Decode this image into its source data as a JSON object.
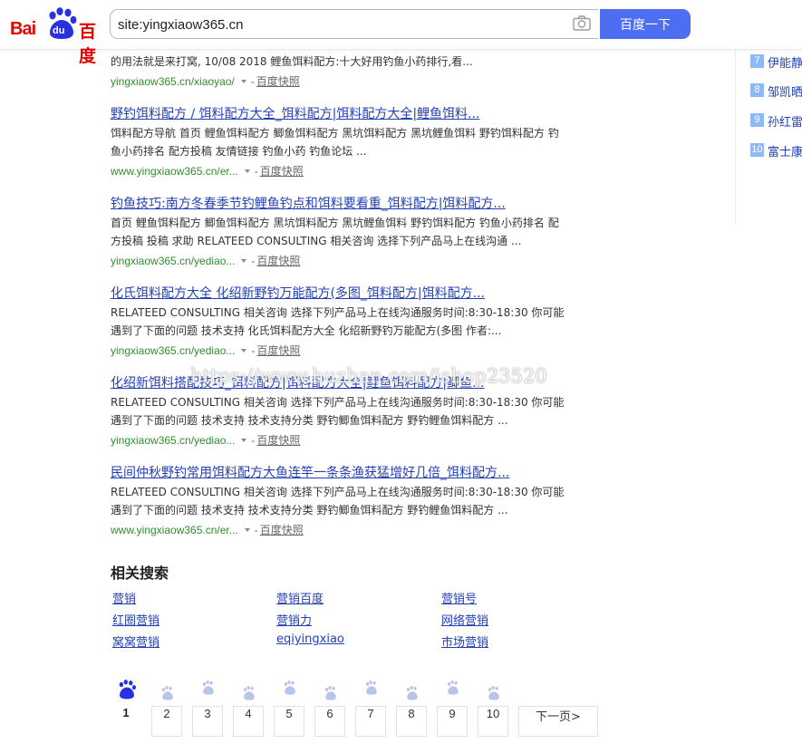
{
  "header": {
    "logo_text_left": "Bai",
    "logo_text_paw": "du",
    "logo_text_right": "百度",
    "search_value": "site:yingxiaow365.cn",
    "search_button": "百度一下",
    "camera_icon": "camera-icon"
  },
  "hot_list": [
    {
      "num": "7",
      "text": "伊能静"
    },
    {
      "num": "8",
      "text": "邹凯晒"
    },
    {
      "num": "9",
      "text": "孙红雷"
    },
    {
      "num": "10",
      "text": "富士康"
    }
  ],
  "top_partial": {
    "snippet": "的用法就是来打窝, 10/08 2018 鲤鱼饵料配方:十大好用钓鱼小药排行,看...",
    "url": "yingxiaow365.cn/xiaoyao/",
    "snapshot": "百度快照"
  },
  "results": [
    {
      "title": "野钓饵料配方 / 饵料配方大全_饵料配方|饵料配方大全|鲤鱼饵料...",
      "lines": [
        "饵料配方导航 首页 鲤鱼饵料配方 鲫鱼饵料配方 黑坑饵料配方 黑坑鲤鱼饵料 野钓饵料配方 钓",
        "鱼小药排名 配方投稿 友情链接 钓鱼小药 钓鱼论坛 ..."
      ],
      "url": "www.yingxiaow365.cn/er...",
      "snapshot": "百度快照"
    },
    {
      "title": "钓鱼技巧:南方冬春季节钓鲤鱼钓点和饵料要看重_饵料配方|饵料配方...",
      "lines": [
        "首页 鲤鱼饵料配方 鲫鱼饵料配方 黑坑饵料配方 黑坑鲤鱼饵料 野钓饵料配方 钓鱼小药排名 配",
        "方投稿 投稿 求助 RELATEED CONSULTING 相关咨询 选择下列产品马上在线沟通 ..."
      ],
      "url": "yingxiaow365.cn/yediao...",
      "snapshot": "百度快照"
    },
    {
      "title": "化氏饵料配方大全 化绍新野钓万能配方(多图_饵料配方|饵料配方...",
      "lines": [
        "RELATEED CONSULTING 相关咨询 选择下列产品马上在线沟通服务时间:8:30-18:30 你可能",
        "遇到了下面的问题 技术支持 化氏饵料配方大全 化绍新野钓万能配方(多图 作者:..."
      ],
      "url": "yingxiaow365.cn/yediao...",
      "snapshot": "百度快照"
    },
    {
      "title": "化绍新饵料搭配技巧_饵料配方|饵料配方大全|鲤鱼饵料配方|鲫鱼...",
      "lines": [
        "RELATEED CONSULTING 相关咨询 选择下列产品马上在线沟通服务时间:8:30-18:30 你可能",
        "遇到了下面的问题 技术支持 技术支持分类 野钓鲫鱼饵料配方 野钓鲤鱼饵料配方 ..."
      ],
      "url": "yingxiaow365.cn/yediao...",
      "snapshot": "百度快照"
    },
    {
      "title": "民间仲秋野钓常用饵料配方大鱼连竿一条条渔获猛增好几倍_饵料配方...",
      "lines": [
        "RELATEED CONSULTING 相关咨询 选择下列产品马上在线沟通服务时间:8:30-18:30 你可能",
        "遇到了下面的问题 技术支持 技术支持分类 野钓鲫鱼饵料配方 野钓鲤鱼饵料配方 ..."
      ],
      "url": "www.yingxiaow365.cn/er...",
      "snapshot": "百度快照"
    }
  ],
  "watermark": "https://www.huzhan.com/ishop23520",
  "related": {
    "title": "相关搜索",
    "items": [
      "营销",
      "营销百度",
      "营销号",
      "红圈营销",
      "营销力",
      "网络营销",
      "窝窝营销",
      "eqiyingxiao",
      "市场营销"
    ]
  },
  "pagination": {
    "pages": [
      "1",
      "2",
      "3",
      "4",
      "5",
      "6",
      "7",
      "8",
      "9",
      "10"
    ],
    "current": "1",
    "next": "下一页>"
  },
  "colors": {
    "brand_red": "#e10601",
    "brand_blue": "#2932e1",
    "button_blue": "#4e6ef2",
    "link_blue": "#2440b3",
    "url_green": "#2e8e2e"
  }
}
